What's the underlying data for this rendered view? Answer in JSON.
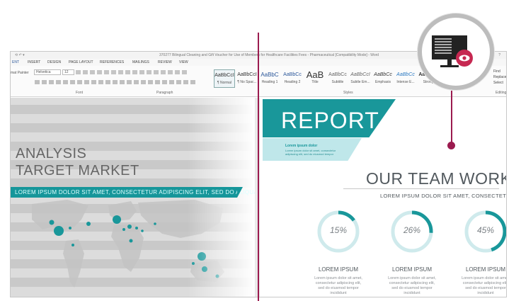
{
  "window": {
    "title": "370277 Bilingual Cleaning and Gift Voucher for Use of Members for Healthcare Facilities Fees - Pharmaceutical [Compatibility Mode] - Word",
    "quick_access": "⟲ ↶ ▾",
    "help": "?"
  },
  "ribbon": {
    "tabs": [
      "ENT",
      "INSERT",
      "DESIGN",
      "PAGE LAYOUT",
      "REFERENCES",
      "MAILINGS",
      "REVIEW",
      "VIEW"
    ],
    "format_painter": "mat Painter",
    "font_name": "Helvetica",
    "font_size": "12",
    "groups": {
      "font": "Font",
      "paragraph": "Paragraph",
      "styles": "Styles",
      "editing": "Editing"
    },
    "styles": [
      {
        "sample": "AaBbCcI",
        "name": "¶ Normal",
        "selected": true
      },
      {
        "sample": "AaBbCcI",
        "name": "¶ No Spac..."
      },
      {
        "sample": "AaBbC",
        "name": "Heading 1"
      },
      {
        "sample": "AaBbCc",
        "name": "Heading 2"
      },
      {
        "sample": "AaB",
        "name": "Title"
      },
      {
        "sample": "AaBbCc",
        "name": "Subtitle"
      },
      {
        "sample": "AaBbCcI",
        "name": "Subtle Em..."
      },
      {
        "sample": "AaBbCc",
        "name": "Emphasis"
      },
      {
        "sample": "AaBbCc",
        "name": "Intense E..."
      },
      {
        "sample": "AaBbCc",
        "name": "Strong"
      }
    ],
    "editing": {
      "find": "Find",
      "replace": "Replace",
      "select": "Select"
    }
  },
  "left_slide": {
    "title_line1": "ANALYSIS",
    "title_line2": "TARGET MARKET",
    "banner": "LOREM IPSUM DOLOR SIT AMET, CONSECTETUR ADIPISCING ELIT, SED DO ALIQUA"
  },
  "right_slide": {
    "report_label": "REPORT",
    "sub_title": "Lorem ipsum dolor",
    "sub_text": "Lorem ipsum dolor sit amet, consectetur adipiscing elit, sed do eiusmod tempor",
    "team_title": "OUR TEAM WORK",
    "team_sub": "LOREM IPSUM DOLOR SIT AMET, CONSECTETUR",
    "stats": [
      {
        "value": 15,
        "label": "15%",
        "title": "LOREM IPSUM",
        "text": "Lorem ipsum dolor sit amet, consectetur adipiscing elit, sed do eiusmod tempor incididunt"
      },
      {
        "value": 26,
        "label": "26%",
        "title": "LOREM IPSUM",
        "text": "Lorem ipsum dolor sit amet, consectetur adipiscing elit, sed do eiusmod tempor incididunt"
      },
      {
        "value": 45,
        "label": "45%",
        "title": "LOREM IPSUM",
        "text": "Lorem ipsum dolor sit amet, consectetur adipiscing elit, sed do eiusmod tempor incididunt"
      }
    ]
  },
  "colors": {
    "teal": "#19979a",
    "teal_light": "#bfe7ea",
    "ring_track": "#cfeaec",
    "accent": "#9b1b4f",
    "text_dark": "#52595e"
  },
  "icons": {
    "magnifier": "monitor-read-mode-icon",
    "eye": "eye-icon"
  }
}
